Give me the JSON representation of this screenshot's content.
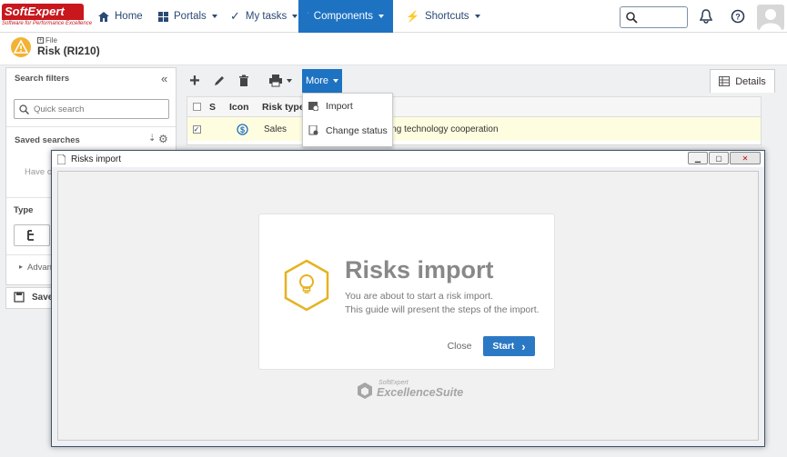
{
  "app": {
    "logo_brand": "SoftExpert",
    "logo_tagline": "Software for Performance Excellence"
  },
  "nav": {
    "home": "Home",
    "portals": "Portals",
    "my_tasks": "My tasks",
    "components": "Components",
    "shortcuts": "Shortcuts"
  },
  "page": {
    "breadcrumb": "File",
    "title": "Risk (RI210)"
  },
  "left_panel": {
    "search_filters": "Search filters",
    "quick_search_placeholder": "Quick search",
    "saved_searches": "Saved searches",
    "saved_hint": "Have o",
    "type_label": "Type",
    "advanced": "Advan",
    "save": "Save"
  },
  "toolbar": {
    "more": "More",
    "details": "Details"
  },
  "more_menu": {
    "items": [
      "Import",
      "Change status"
    ]
  },
  "grid": {
    "columns": [
      "S",
      "Icon",
      "Risk type"
    ],
    "row": {
      "risk_type": "Sales",
      "description": "ing technology cooperation"
    }
  },
  "modal": {
    "window_title": "Risks import",
    "heading": "Risks import",
    "line1": "You are about to start a risk import.",
    "line2": "This guide will present the steps of the import.",
    "close": "Close",
    "start": "Start",
    "brand_small": "SoftExpert",
    "brand_large": "ExcellenceSuite"
  },
  "colors": {
    "accent": "#1e72c2",
    "brand_red": "#c8181e",
    "hex_yellow": "#e6b21e",
    "row_highlight": "#fffde0"
  }
}
